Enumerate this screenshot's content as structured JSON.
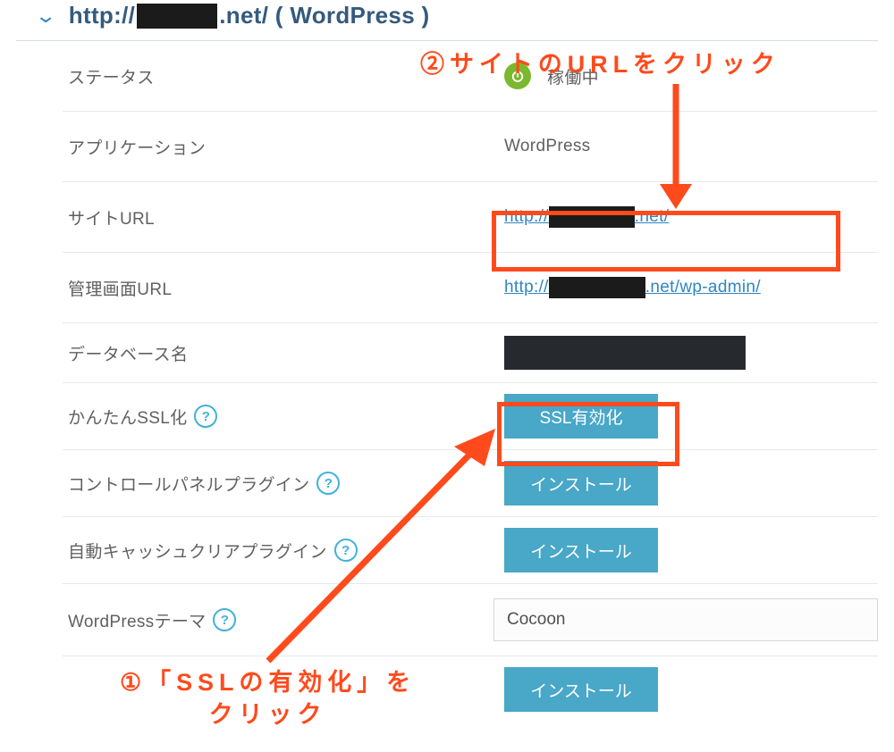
{
  "header": {
    "url_prefix": "http://",
    "url_suffix": ".net/ ( WordPress )"
  },
  "annotations": {
    "top": "②サイトのURLをクリック",
    "bottom_line1": "①「SSLの有効化」を",
    "bottom_line2": "クリック"
  },
  "rows": {
    "status": {
      "label": "ステータス",
      "value": "稼働中"
    },
    "application": {
      "label": "アプリケーション",
      "value": "WordPress"
    },
    "site_url": {
      "label": "サイトURL",
      "prefix": "http://",
      "suffix": ".net/"
    },
    "admin_url": {
      "label": "管理画面URL",
      "prefix": "http://",
      "suffix": ".net/wp-admin/"
    },
    "database": {
      "label": "データベース名"
    },
    "ssl": {
      "label": "かんたんSSL化",
      "button": "SSL有効化"
    },
    "control_plugin": {
      "label": "コントロールパネルプラグイン",
      "button": "インストール"
    },
    "cache_plugin": {
      "label": "自動キャッシュクリアプラグイン",
      "button": "インストール"
    },
    "theme": {
      "label": "WordPressテーマ",
      "value": "Cocoon"
    },
    "install": {
      "button": "インストール"
    }
  }
}
